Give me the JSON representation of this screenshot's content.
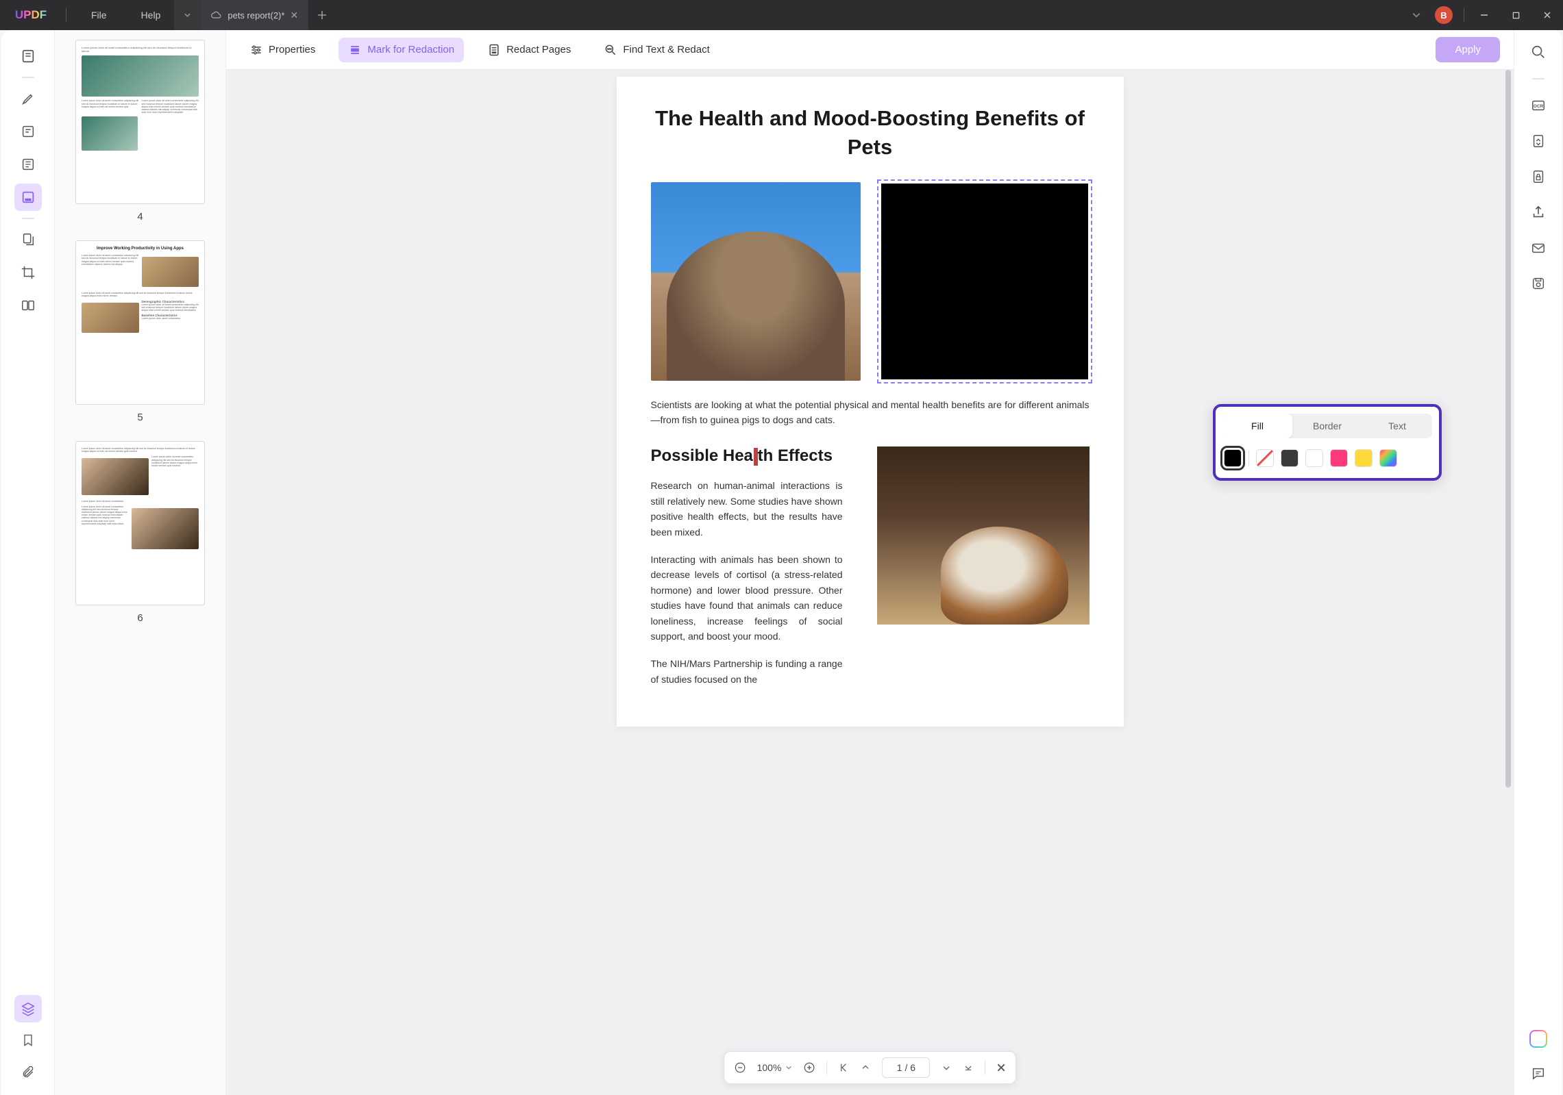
{
  "titlebar": {
    "logo": "UPDF",
    "menu": {
      "file": "File",
      "help": "Help"
    },
    "tab": {
      "name": "pets report(2)*",
      "modified": true
    },
    "avatar_initial": "B"
  },
  "left_tools": [
    {
      "id": "thumbnails",
      "name": "thumbnails-icon"
    },
    {
      "id": "comment",
      "name": "highlighter-icon"
    },
    {
      "id": "edit",
      "name": "edit-text-icon"
    },
    {
      "id": "reader",
      "name": "reader-icon"
    },
    {
      "id": "redact",
      "name": "redact-icon",
      "selected": true
    },
    {
      "id": "organize",
      "name": "pages-icon"
    },
    {
      "id": "crop",
      "name": "crop-icon"
    },
    {
      "id": "compare",
      "name": "compare-icon"
    }
  ],
  "left_bottom": [
    {
      "id": "layers",
      "name": "layers-icon",
      "selected": true
    },
    {
      "id": "bookmarks",
      "name": "bookmark-icon"
    },
    {
      "id": "attachments",
      "name": "attachment-icon"
    }
  ],
  "thumbnails": [
    {
      "page": 4,
      "title": ""
    },
    {
      "page": 5,
      "title": "Improve Working Productivity in Using Apps",
      "subheads": [
        "Demographic Characteristics",
        "Baseline Characteristics"
      ]
    },
    {
      "page": 6,
      "title": ""
    }
  ],
  "toolbar": {
    "properties": "Properties",
    "mark": "Mark for Redaction",
    "pages": "Redact Pages",
    "find": "Find Text & Redact",
    "apply": "Apply"
  },
  "document": {
    "title": "The Health and Mood-Boosting Benefits of Pets",
    "para1": "Scientists are looking at what the potential physical and mental health benefits are for different animals—from fish to guinea pigs to dogs and cats.",
    "h2": "Possible Health Effects",
    "para2": "Research on human-animal interactions is still relatively new. Some studies have shown positive health effects, but the results have been mixed.",
    "para3": "Interacting with animals has been shown to decrease levels of cortisol (a stress-related hormone) and lower blood pressure. Other studies have found that animals can reduce loneliness, increase feelings of social support, and boost your mood.",
    "para4": "The NIH/Mars Partnership is funding a range of studies focused on the"
  },
  "color_popup": {
    "tabs": {
      "fill": "Fill",
      "border": "Border",
      "text": "Text"
    },
    "active_tab": "fill",
    "swatches": [
      {
        "id": "black",
        "color": "#000000",
        "selected": true
      },
      {
        "id": "none",
        "color": "none"
      },
      {
        "id": "dark-gray",
        "color": "#3a3a3a"
      },
      {
        "id": "white",
        "color": "#ffffff"
      },
      {
        "id": "pink",
        "color": "#ff3a7a"
      },
      {
        "id": "yellow",
        "color": "#ffd83a"
      },
      {
        "id": "rainbow",
        "color": "rainbow"
      }
    ]
  },
  "page_nav": {
    "zoom": "100%",
    "page_current": "1",
    "page_sep": "/",
    "page_total": "6"
  },
  "right_tools": [
    {
      "id": "search",
      "name": "search-icon"
    },
    {
      "id": "ocr",
      "name": "ocr-icon",
      "label": "OCR"
    },
    {
      "id": "convert",
      "name": "convert-icon"
    },
    {
      "id": "protect",
      "name": "lock-icon"
    },
    {
      "id": "share",
      "name": "share-icon"
    },
    {
      "id": "email",
      "name": "mail-icon"
    },
    {
      "id": "save",
      "name": "save-icon"
    }
  ],
  "right_bottom": [
    {
      "id": "ai",
      "name": "ai-icon"
    },
    {
      "id": "chat",
      "name": "chat-icon"
    }
  ]
}
